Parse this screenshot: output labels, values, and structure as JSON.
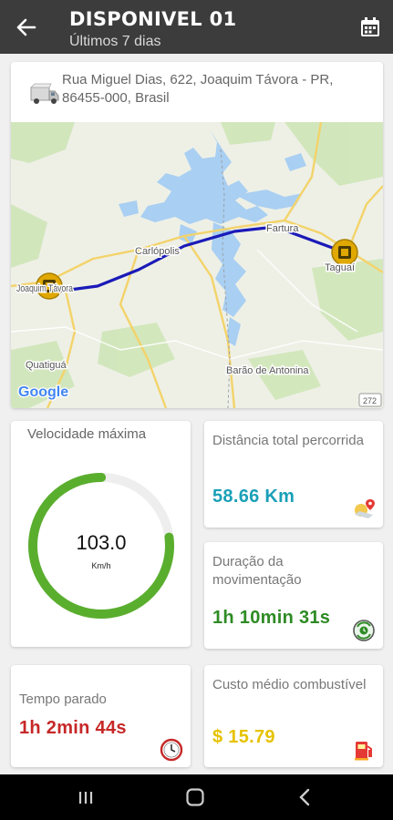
{
  "header": {
    "title": "DISPONIVEL 01",
    "subtitle": "Últimos 7 dias",
    "back_icon": "arrow-left-icon",
    "calendar_icon": "calendar-icon"
  },
  "location": {
    "address": "Rua Miguel Dias, 622, Joaquim Távora - PR, 86455-000, Brasil",
    "icon": "truck-icon"
  },
  "map": {
    "labels": {
      "carlopolis": "Carlópolis",
      "fartura": "Fartura",
      "taguai": "Taguaí",
      "joaquim_tavora": "Joaquim Távora",
      "quatigua": "Quatiguá",
      "barao": "Barão de Antonina",
      "google": "Google",
      "road_272": "272"
    },
    "route_color": "#1a1ab8",
    "marker_color": "#e0a800"
  },
  "speed": {
    "label": "Velocidade máxima",
    "value": "103.0",
    "unit": "Km/h",
    "fill_fraction": 0.77,
    "color": "#5aae2e"
  },
  "distance": {
    "label": "Distância total percorrida",
    "value": "58.66 Km",
    "color": "#1aa0b8",
    "icon": "map-pin-icon"
  },
  "duration": {
    "label": "Duração da movimentação",
    "value": "1h 10min 31s",
    "color": "#2e8b24",
    "icon": "cycle-timer-icon"
  },
  "stopped": {
    "label": "Tempo parado",
    "value": "1h 2min 44s",
    "color": "#c62828",
    "icon": "stopwatch-icon"
  },
  "fuel": {
    "label": "Custo médio combustível",
    "value": "$ 15.79",
    "color": "#e6c200",
    "icon": "fuel-pump-icon"
  },
  "navbar": {
    "recents_icon": "recents-icon",
    "home_icon": "home-icon",
    "back_icon": "back-chevron-icon"
  }
}
